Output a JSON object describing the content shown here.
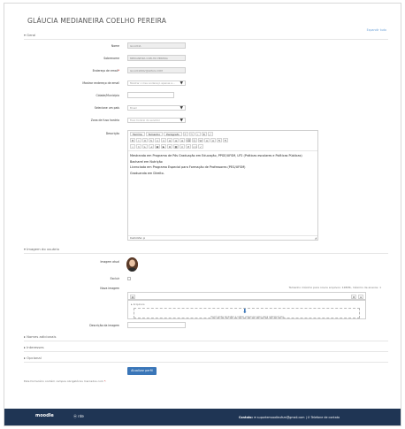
{
  "user": {
    "full_name": "GLÁUCIA MEDIANEIRA COELHO PEREIRA"
  },
  "expand_all": "Expandir tudo",
  "sections": {
    "general": "Geral",
    "user_picture": "Imagem do usuário",
    "additional_names": "Nomes adicionais",
    "interests": "Interesses",
    "optional": "Opcional"
  },
  "fields": {
    "first_name": {
      "label": "Nome",
      "value": "GLAUCIA"
    },
    "surname": {
      "label": "Sobrenome",
      "value": "MEDIANEIRA COELHO PEREIRA"
    },
    "email": {
      "label": "Endereço de email",
      "value": "GLAUCIAPAV@GMAIL.COM"
    },
    "email_display": {
      "label": "Mostrar endereço de email",
      "value": "Mostrar o meu endereço apenas a..."
    },
    "city": {
      "label": "Cidade/Município",
      "value": ""
    },
    "country": {
      "label": "Selecione um país",
      "value": "Brasil"
    },
    "timezone": {
      "label": "Zona de fuso horário",
      "value": "Fuso horário do servidor"
    },
    "description": {
      "label": "Descrição"
    },
    "current_picture": {
      "label": "Imagem atual"
    },
    "delete": {
      "label": "Excluir"
    },
    "new_picture": {
      "label": "Nova imagem"
    },
    "picture_description": {
      "label": "Descrição da imagem",
      "value": ""
    }
  },
  "editor": {
    "font_family": "Família",
    "font_size": "Tamanho",
    "paragraph": "Parágrafo",
    "lines": [
      "Mestranda em Programa de Pós Graduação em Educação, PPGE/UFSM, LP2 (Práticas escolares e Políticas Públicas)",
      "Bacharel em Nutrição",
      "Licenciada em Programa Especial para Formação de Professores (PEG/UFSM)",
      "Graduanda em Direito."
    ],
    "path": "Caminho: p"
  },
  "filepicker": {
    "max_size": "Tamanho máximo para novos arquivos: 128Mb, máximo de anexos: 1",
    "folder": "Arquivos",
    "hint": "Você pode arrastar e soltar arquivos aqui para adicioná-los."
  },
  "update_button": "Atualizar perfil",
  "required_note": "Este formulário contém campos obrigatórios marcados com",
  "footer": {
    "brand": "moodle",
    "partner": "nte",
    "contact_label": "Contato:",
    "email": "suportemoodleufsm@gmail.com",
    "phone": "Telefone de contato"
  },
  "colors": {
    "accent": "#3a76b8",
    "footer": "#1f3554",
    "link": "#6fa3d8",
    "required": "#cc0000"
  },
  "icons": [
    "user-avatar",
    "download-arrow-icon",
    "folder-icon",
    "caret-down-icon",
    "mail-icon",
    "phone-icon"
  ]
}
